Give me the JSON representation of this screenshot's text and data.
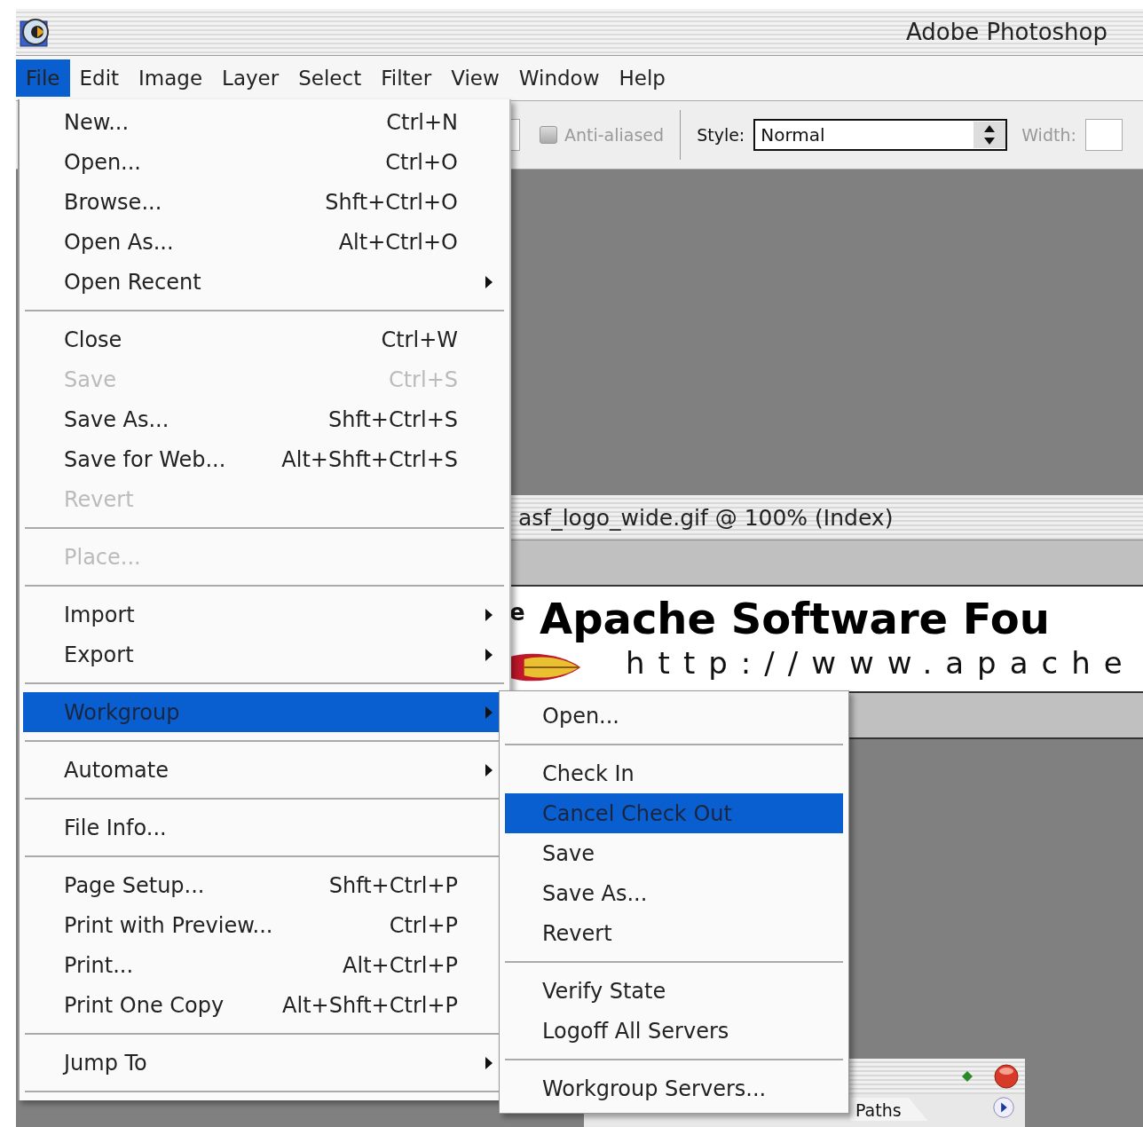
{
  "window": {
    "title": "Adobe Photoshop"
  },
  "menu_bar": [
    {
      "label": "File",
      "selected": true
    },
    {
      "label": "Edit",
      "selected": false
    },
    {
      "label": "Image",
      "selected": false
    },
    {
      "label": "Layer",
      "selected": false
    },
    {
      "label": "Select",
      "selected": false
    },
    {
      "label": "Filter",
      "selected": false
    },
    {
      "label": "View",
      "selected": false
    },
    {
      "label": "Window",
      "selected": false
    },
    {
      "label": "Help",
      "selected": false
    }
  ],
  "options_bar": {
    "anti_aliased": {
      "label": "Anti-aliased",
      "checked": false,
      "disabled": true
    },
    "style": {
      "label": "Style:",
      "value": "Normal"
    },
    "width": {
      "label": "Width:",
      "disabled": true
    }
  },
  "document": {
    "title": "asf_logo_wide.gif @ 100% (Index)",
    "image": {
      "fragment": "e",
      "heading": "Apache Software Fou",
      "url": "http://www.apache"
    }
  },
  "file_menu": [
    {
      "kind": "item",
      "label": "New...",
      "shortcut": "Ctrl+N",
      "disabled": false,
      "selected": false,
      "submenu": false
    },
    {
      "kind": "item",
      "label": "Open...",
      "shortcut": "Ctrl+O",
      "disabled": false,
      "selected": false,
      "submenu": false
    },
    {
      "kind": "item",
      "label": "Browse...",
      "shortcut": "Shft+Ctrl+O",
      "disabled": false,
      "selected": false,
      "submenu": false
    },
    {
      "kind": "item",
      "label": "Open As...",
      "shortcut": "Alt+Ctrl+O",
      "disabled": false,
      "selected": false,
      "submenu": false
    },
    {
      "kind": "item",
      "label": "Open Recent",
      "disabled": false,
      "selected": false,
      "submenu": true
    },
    {
      "kind": "separator"
    },
    {
      "kind": "item",
      "label": "Close",
      "shortcut": "Ctrl+W",
      "disabled": false,
      "selected": false,
      "submenu": false
    },
    {
      "kind": "item",
      "label": "Save",
      "shortcut": "Ctrl+S",
      "disabled": true,
      "selected": false,
      "submenu": false
    },
    {
      "kind": "item",
      "label": "Save As...",
      "shortcut": "Shft+Ctrl+S",
      "disabled": false,
      "selected": false,
      "submenu": false
    },
    {
      "kind": "item",
      "label": "Save for Web...",
      "shortcut": "Alt+Shft+Ctrl+S",
      "disabled": false,
      "selected": false,
      "submenu": false
    },
    {
      "kind": "item",
      "label": "Revert",
      "disabled": true,
      "selected": false,
      "submenu": false
    },
    {
      "kind": "separator"
    },
    {
      "kind": "item",
      "label": "Place...",
      "disabled": true,
      "selected": false,
      "submenu": false
    },
    {
      "kind": "separator"
    },
    {
      "kind": "item",
      "label": "Import",
      "disabled": false,
      "selected": false,
      "submenu": true
    },
    {
      "kind": "item",
      "label": "Export",
      "disabled": false,
      "selected": false,
      "submenu": true
    },
    {
      "kind": "separator"
    },
    {
      "kind": "item",
      "label": "Workgroup",
      "disabled": false,
      "selected": true,
      "submenu": true
    },
    {
      "kind": "separator"
    },
    {
      "kind": "item",
      "label": "Automate",
      "disabled": false,
      "selected": false,
      "submenu": true
    },
    {
      "kind": "separator"
    },
    {
      "kind": "item",
      "label": "File Info...",
      "disabled": false,
      "selected": false,
      "submenu": false
    },
    {
      "kind": "separator"
    },
    {
      "kind": "item",
      "label": "Page Setup...",
      "shortcut": "Shft+Ctrl+P",
      "disabled": false,
      "selected": false,
      "submenu": false
    },
    {
      "kind": "item",
      "label": "Print with Preview...",
      "shortcut": "Ctrl+P",
      "disabled": false,
      "selected": false,
      "submenu": false
    },
    {
      "kind": "item",
      "label": "Print...",
      "shortcut": "Alt+Ctrl+P",
      "disabled": false,
      "selected": false,
      "submenu": false
    },
    {
      "kind": "item",
      "label": "Print One Copy",
      "shortcut": "Alt+Shft+Ctrl+P",
      "disabled": false,
      "selected": false,
      "submenu": false
    },
    {
      "kind": "separator"
    },
    {
      "kind": "item",
      "label": "Jump To",
      "disabled": false,
      "selected": false,
      "submenu": true
    },
    {
      "kind": "separator"
    }
  ],
  "workgroup_submenu": [
    {
      "kind": "item",
      "label": "Open...",
      "selected": false
    },
    {
      "kind": "separator"
    },
    {
      "kind": "item",
      "label": "Check In",
      "selected": false
    },
    {
      "kind": "item",
      "label": "Cancel Check Out",
      "selected": true
    },
    {
      "kind": "item",
      "label": "Save",
      "selected": false
    },
    {
      "kind": "item",
      "label": "Save As...",
      "selected": false
    },
    {
      "kind": "item",
      "label": "Revert",
      "selected": false
    },
    {
      "kind": "separator"
    },
    {
      "kind": "item",
      "label": "Verify State",
      "selected": false
    },
    {
      "kind": "item",
      "label": "Logoff All Servers",
      "selected": false
    },
    {
      "kind": "separator"
    },
    {
      "kind": "item",
      "label": "Workgroup Servers...",
      "selected": false
    }
  ],
  "palette": {
    "tabs": [
      {
        "label": "Paths",
        "selected": false
      }
    ]
  }
}
